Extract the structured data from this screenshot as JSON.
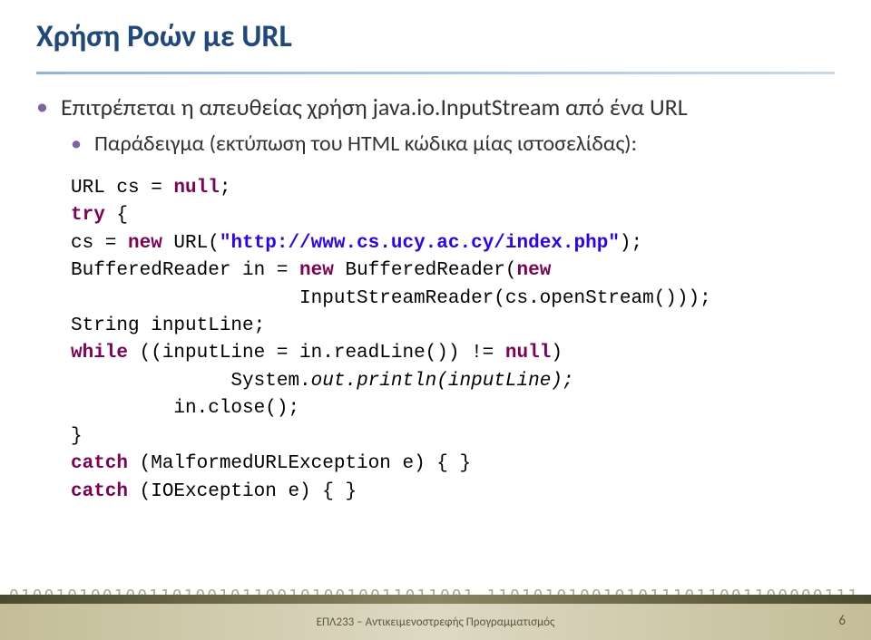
{
  "title": "Χρήση Ροών με URL",
  "bullet1": "Επιτρέπεται η απευθείας χρήση java.io.InputStream από ένα URL",
  "bullet2": "Παράδειγμα (εκτύπωση του HTML κώδικα μίας ιστοσελίδας):",
  "code": {
    "line1a": "URL cs = ",
    "line1b": "null",
    "line1c": ";",
    "line2a": "try",
    "line2b": " {",
    "line3a": "cs = ",
    "line3b": "new",
    "line3c": " URL(",
    "line3d": "\"http://www.cs.ucy.ac.cy/index.php\"",
    "line3e": ");",
    "line4a": "BufferedReader in = ",
    "line4b": "new",
    "line4c": " BufferedReader(",
    "line4d": "new",
    "line5a": "                    InputStreamReader(cs.openStream()));",
    "line6": "String inputLine;",
    "line7a": "while",
    "line7b": " ((inputLine = in.readLine()) != ",
    "line7c": "null",
    "line7d": ")",
    "line8a": "              System.",
    "line8b": "out",
    "line8c": ".println(inputLine);",
    "line9": "         in.close();",
    "line10": "}",
    "line11a": "catch",
    "line11b": " (MalformedURLException e) { }",
    "line12a": "catch",
    "line12b": " (IOException e) { }"
  },
  "footer": "ΕΠΛ233 – Αντικειμενοστρεφής Προγραμματισμός",
  "pageNum": "6",
  "binary": "0100101001001101001011001010010011011001 11010101001010111011001100000111"
}
